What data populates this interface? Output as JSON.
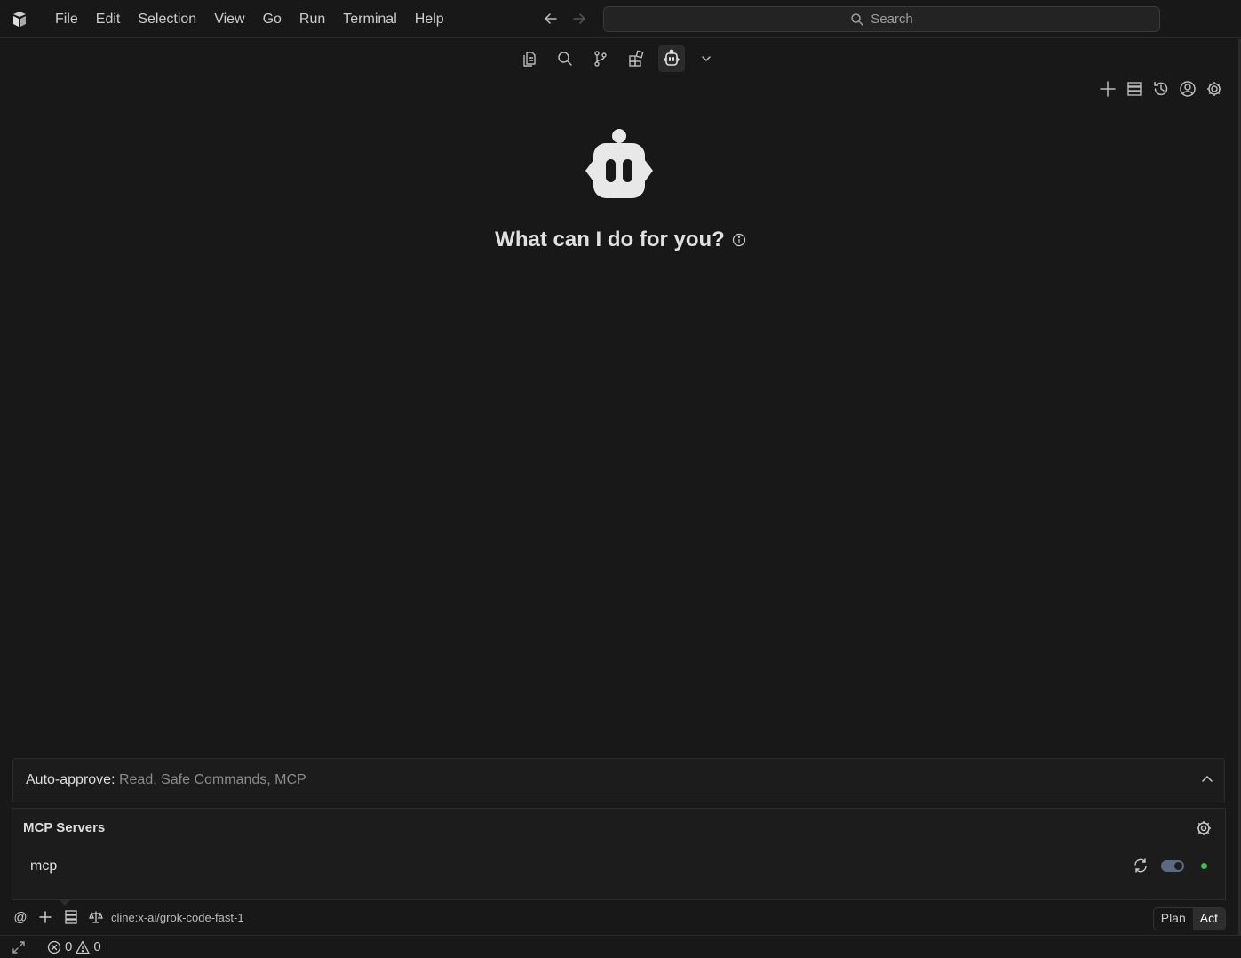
{
  "menu": {
    "items": [
      "File",
      "Edit",
      "Selection",
      "View",
      "Go",
      "Run",
      "Terminal",
      "Help"
    ]
  },
  "search": {
    "label": "Search"
  },
  "welcome": {
    "title": "What can I do for you?"
  },
  "auto_approve": {
    "label": "Auto-approve:",
    "value": "Read, Safe Commands, MCP"
  },
  "mcp": {
    "title": "MCP Servers",
    "servers": [
      {
        "name": "mcp",
        "enabled": true,
        "status_color": "#3fb950"
      }
    ]
  },
  "input_bar": {
    "mention_label": "@",
    "model": "cline:x-ai/grok-code-fast-1",
    "modes": [
      "Plan",
      "Act"
    ],
    "active_mode": "Act"
  },
  "status_bar": {
    "errors": "0",
    "warnings": "0"
  },
  "icons": {
    "activity": [
      "explorer-icon",
      "search-icon",
      "source-control-icon",
      "extensions-icon",
      "cline-robot-icon",
      "chevron-down-icon"
    ],
    "panel": [
      "plus-icon",
      "server-stack-icon",
      "history-icon",
      "account-icon",
      "settings-gear-icon"
    ]
  },
  "colors": {
    "background": "#181818",
    "panel_background": "#1c1c1c",
    "accent_status": "#3fb950",
    "toggle": "#5a6a82"
  }
}
